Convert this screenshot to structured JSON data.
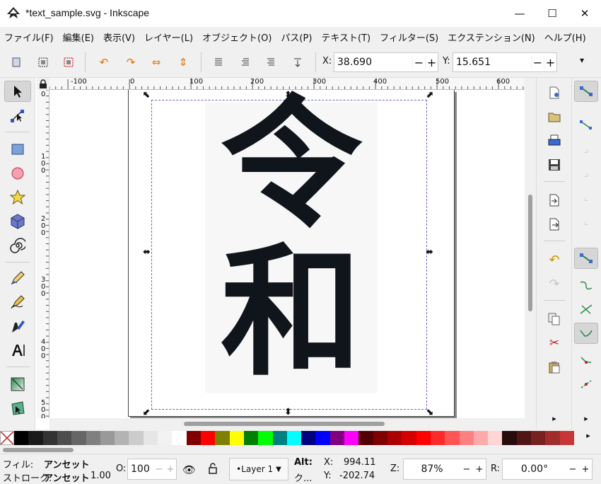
{
  "window": {
    "title": "*text_sample.svg - Inkscape",
    "minimize_glyph": "—",
    "maximize_glyph": "☐",
    "close_glyph": "✕"
  },
  "menu": [
    "ファイル(F)",
    "編集(E)",
    "表示(V)",
    "レイヤー(L)",
    "オブジェクト(O)",
    "パス(P)",
    "テキスト(T)",
    "フィルター(S)",
    "エクステンション(N)",
    "ヘルプ(H)"
  ],
  "toolbar": {
    "x_label": "X:",
    "x_value": "38.690",
    "y_label": "Y:",
    "y_value": "15.651",
    "minus": "−",
    "plus": "+",
    "more": "▾"
  },
  "ruler_top_labels": [
    "-100",
    "0",
    "100",
    "200",
    "300",
    "400",
    "500",
    "600"
  ],
  "ruler_left_labels": [
    "0",
    "1 0 0",
    "2 0 0",
    "3 0 0",
    "4 0 0",
    "5 0 0"
  ],
  "canvas_text": {
    "char1": "令",
    "char2": "和"
  },
  "colors": {
    "palette": [
      "#000000",
      "#1a1a1a",
      "#333333",
      "#4d4d4d",
      "#666666",
      "#808080",
      "#999999",
      "#b3b3b3",
      "#cccccc",
      "#e6e6e6",
      "#f2f2f2",
      "#ffffff",
      "#800000",
      "#ff0000",
      "#808000",
      "#ffff00",
      "#008000",
      "#00ff00",
      "#008080",
      "#00ffff",
      "#000080",
      "#0000ff",
      "#800080",
      "#ff00ff",
      "#550000",
      "#800000",
      "#aa0000",
      "#d40000",
      "#ff0000",
      "#ff2a2a",
      "#ff5555",
      "#ff8080",
      "#ffaaaa",
      "#ffd5d5",
      "#280b0b",
      "#501616",
      "#782121",
      "#a02c2c",
      "#c83737"
    ],
    "ink": "#10151c"
  },
  "status": {
    "fill_label": "フィル:",
    "fill_value": "アンセット",
    "stroke_label": "ストローク:",
    "stroke_value": "アンセット",
    "stroke_width": "1.00",
    "opacity_label": "O:",
    "opacity_value": "100",
    "layer": "•Layer 1",
    "alt_label": "Alt:",
    "alt_value": "ク...",
    "cursor_x_label": "X:",
    "cursor_x": "994.11",
    "cursor_y_label": "Y:",
    "cursor_y": "-202.74",
    "zoom_label": "Z:",
    "zoom": "87%",
    "rotate_label": "R:",
    "rotate": "0.00°"
  }
}
